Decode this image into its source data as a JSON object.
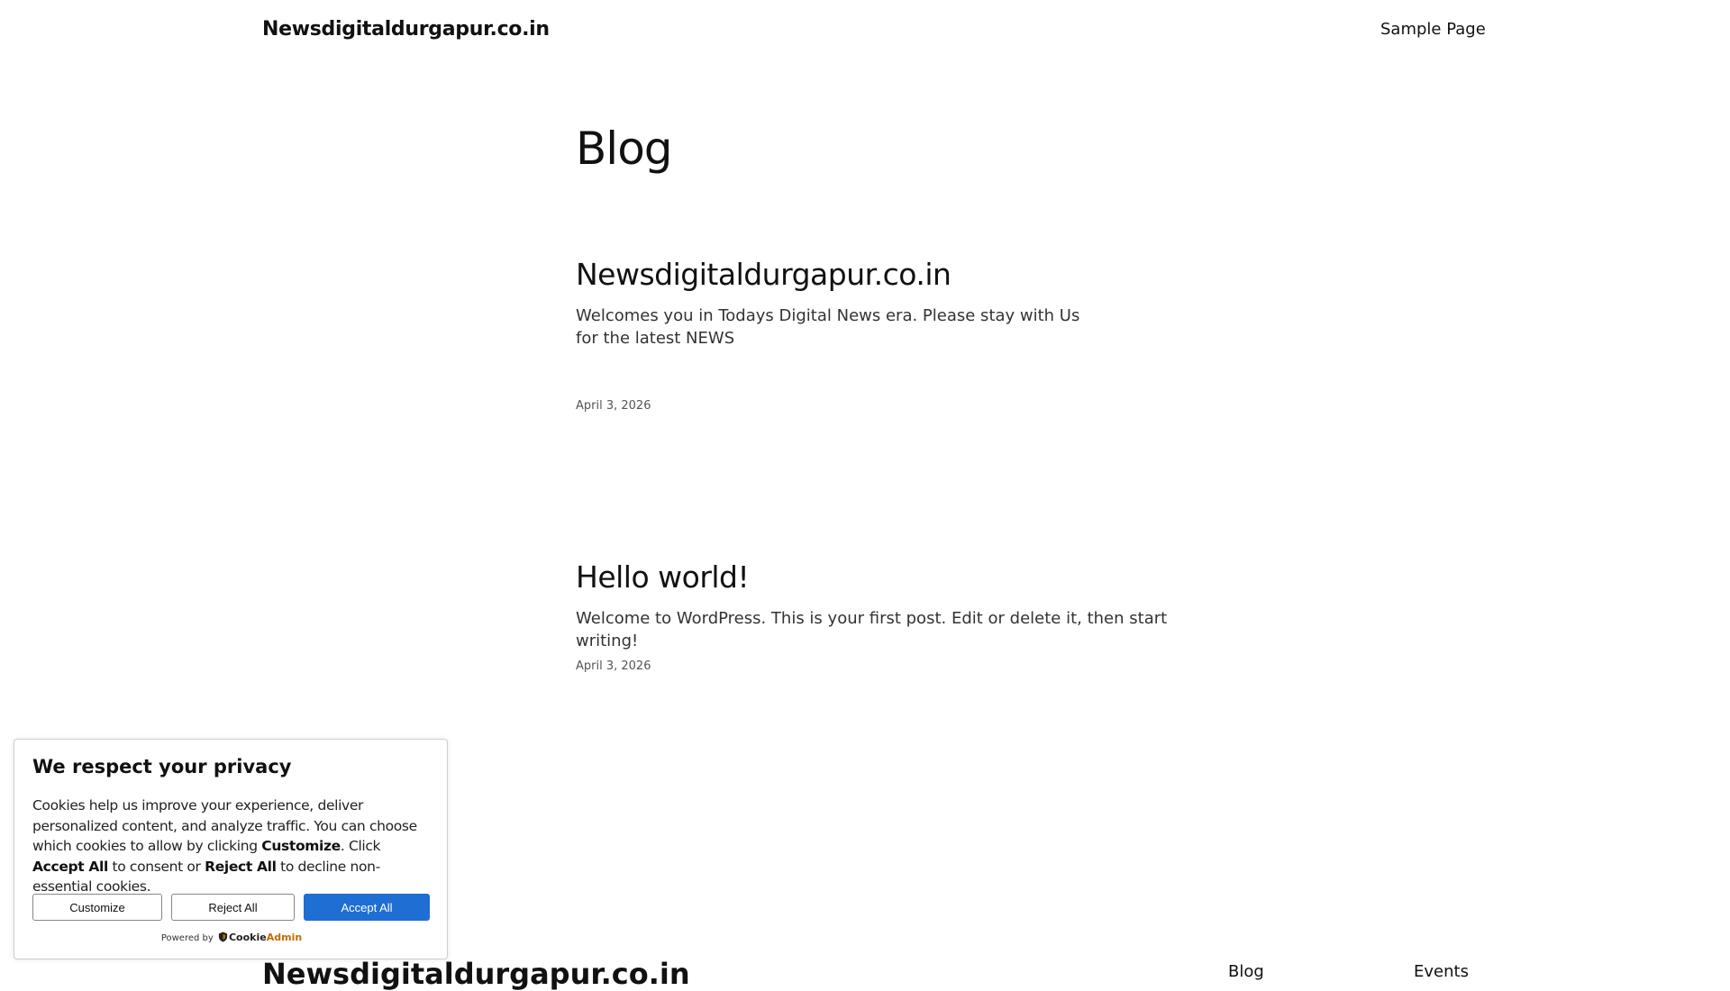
{
  "header": {
    "site_title": "Newsdigitaldurgapur.co.in",
    "nav": [
      {
        "label": "Sample Page"
      }
    ]
  },
  "main": {
    "page_title": "Blog",
    "posts": [
      {
        "title": "Newsdigitaldurgapur.co.in",
        "excerpt": "Welcomes you in Todays Digital News era. Please stay with Us for the latest NEWS",
        "date": "April 3, 2026"
      },
      {
        "title": "Hello world!",
        "excerpt": "Welcome to WordPress. This is your first post. Edit or delete it, then start writing!",
        "date": "April 3, 2026"
      }
    ]
  },
  "footer": {
    "site_title": "Newsdigitaldurgapur.co.in",
    "links": [
      {
        "label": "Blog"
      },
      {
        "label": "Events"
      }
    ]
  },
  "cookie": {
    "heading": "We respect your privacy",
    "text_1": "Cookies help us improve your experience, deliver personalized content, and analyze traffic. You can choose which cookies to allow by clicking ",
    "text_customize": "Customize",
    "text_2": ". Click ",
    "text_accept": "Accept All",
    "text_3": " to consent or ",
    "text_reject": "Reject All",
    "text_4": " to decline non-essential cookies.",
    "buttons": {
      "customize": "Customize",
      "reject": "Reject All",
      "accept": "Accept All"
    },
    "powered_by": "Powered by",
    "brand_part1": "Cookie",
    "brand_part2": "Admin",
    "colors": {
      "accept_button": "#1f6ed4",
      "brand_accent": "#c46a00"
    },
    "icons": {
      "brand": "shield-icon"
    }
  }
}
